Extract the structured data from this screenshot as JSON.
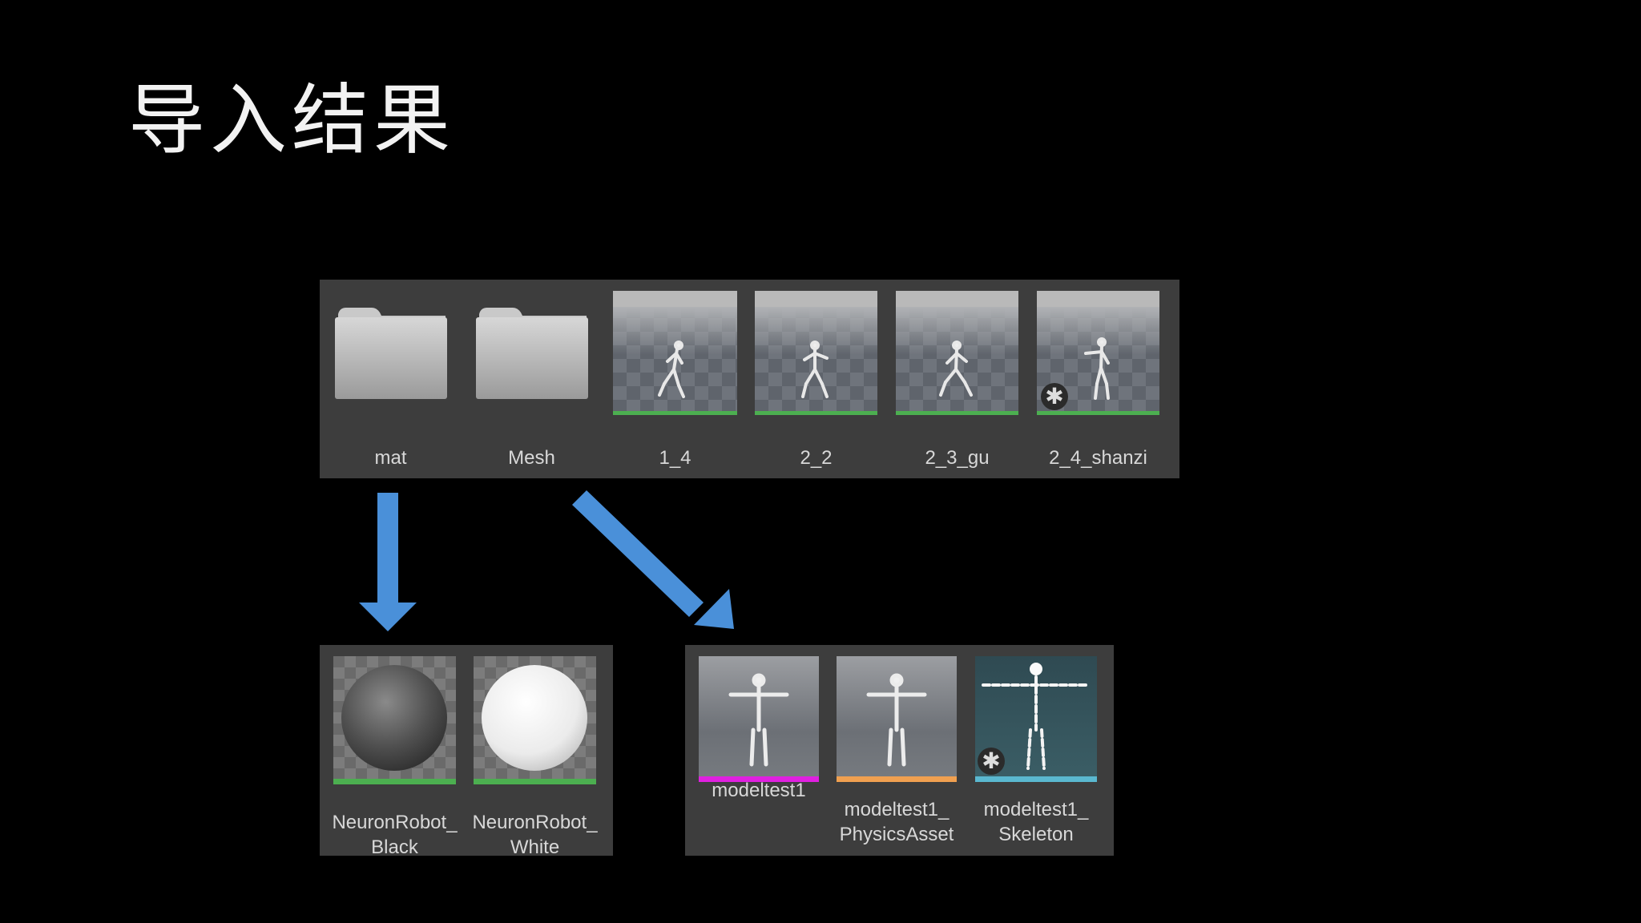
{
  "slide": {
    "title": "导入结果"
  },
  "colors": {
    "background": "#000000",
    "panel": "#3d3d3d",
    "arrow": "#4a90d9",
    "material_bar": "#4caf50",
    "anim_bar": "#4caf50",
    "skeletal_mesh_bar": "#e020e0",
    "physics_asset_bar": "#f0a050",
    "skeleton_bar": "#5ab8d0"
  },
  "top_row": [
    {
      "label": "mat",
      "kind": "folder",
      "icon": "folder-icon"
    },
    {
      "label": "Mesh",
      "kind": "folder",
      "icon": "folder-icon"
    },
    {
      "label": "1_4",
      "kind": "animation",
      "icon": "animation-thumbnail"
    },
    {
      "label": "2_2",
      "kind": "animation",
      "icon": "animation-thumbnail"
    },
    {
      "label": "2_3_gu",
      "kind": "animation",
      "icon": "animation-thumbnail"
    },
    {
      "label": "2_4_shanzi",
      "kind": "animation",
      "icon": "animation-thumbnail",
      "badge": "star-badge-icon"
    }
  ],
  "materials": [
    {
      "label": "NeuronRobot_\nBlack",
      "icon": "material-sphere-icon",
      "sphere": "#555555"
    },
    {
      "label": "NeuronRobot_\nWhite",
      "icon": "material-sphere-icon",
      "sphere": "#f0f0f0"
    }
  ],
  "meshes": [
    {
      "label": "modeltest1",
      "icon": "skeletal-mesh-icon"
    },
    {
      "label": "modeltest1_\nPhysicsAsset",
      "icon": "physics-asset-icon"
    },
    {
      "label": "modeltest1_\nSkeleton",
      "icon": "skeleton-icon",
      "badge": "star-badge-icon"
    }
  ]
}
